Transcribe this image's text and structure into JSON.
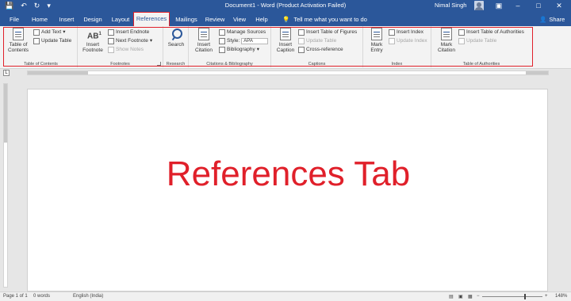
{
  "titlebar": {
    "title": "Document1 - Word (Product Activation Failed)",
    "user": "Nimal Singh",
    "qat": [
      "save-icon",
      "undo-icon",
      "redo-icon",
      "customize-icon"
    ],
    "window_buttons": [
      "ribbon-options-icon",
      "minimize-icon",
      "restore-icon",
      "close-icon"
    ]
  },
  "tabs": [
    "File",
    "Home",
    "Insert",
    "Design",
    "Layout",
    "References",
    "Mailings",
    "Review",
    "View",
    "Help"
  ],
  "active_tab": "References",
  "tellme": "Tell me what you want to do",
  "share": "Share",
  "groups": {
    "toc": {
      "label": "Table of Contents",
      "toc_button": "Table of\nContents",
      "add_text": "Add Text",
      "update_table": "Update Table"
    },
    "footnotes": {
      "label": "Footnotes",
      "insert_footnote": "Insert\nFootnote",
      "insert_endnote": "Insert Endnote",
      "next_footnote": "Next Footnote",
      "show_notes": "Show Notes"
    },
    "research": {
      "label": "Research",
      "search": "Search"
    },
    "citations": {
      "label": "Citations & Bibliography",
      "insert_citation": "Insert\nCitation",
      "manage_sources": "Manage Sources",
      "style_label": "Style:",
      "style_value": "APA",
      "bibliography": "Bibliography"
    },
    "captions": {
      "label": "Captions",
      "insert_caption": "Insert\nCaption",
      "insert_table_of_figures": "Insert Table of Figures",
      "update_table": "Update Table",
      "cross_reference": "Cross-reference"
    },
    "index": {
      "label": "Index",
      "mark_entry": "Mark\nEntry",
      "insert_index": "Insert Index",
      "update_index": "Update Index"
    },
    "authorities": {
      "label": "Table of Authorities",
      "mark_citation": "Mark\nCitation",
      "insert_table_of_authorities": "Insert Table of Authorities",
      "update_table": "Update Table"
    }
  },
  "document": {
    "heading": "References Tab"
  },
  "statusbar": {
    "page": "Page 1 of 1",
    "words": "0 words",
    "language": "English (India)",
    "zoom": "148%"
  },
  "colors": {
    "accent": "#2b579a",
    "highlight": "#e0202a"
  }
}
